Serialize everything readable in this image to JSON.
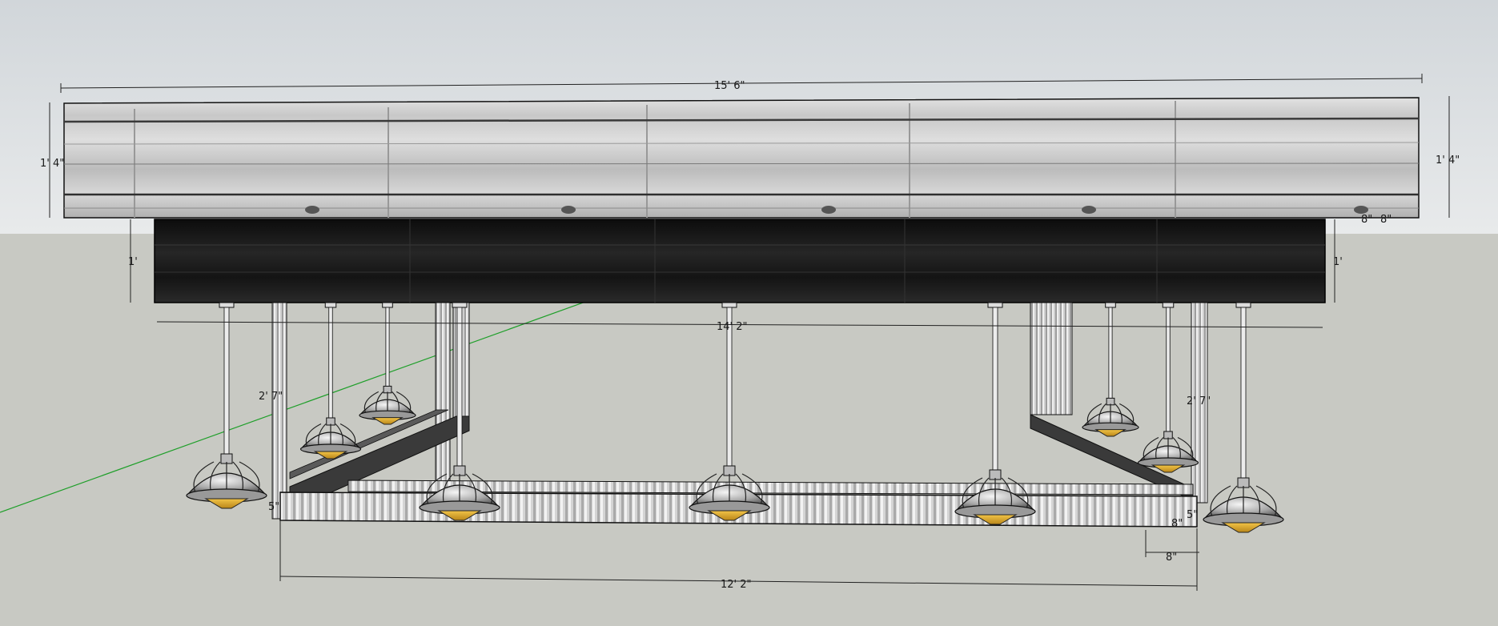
{
  "colors": {
    "sky_top": "#d3d8dc",
    "sky_bottom": "#e6e8e9",
    "ground": "#c8c9c3",
    "wood_light": "#d6d6d6",
    "wood_dark": "#151515",
    "metal": "#cfcfcf",
    "lamp_amber": "#e0a92a",
    "axis_green": "#22a02a",
    "outline": "#111111"
  },
  "dimensions": {
    "top_width": "15' 6\"",
    "top_height_left": "1' 4\"",
    "top_height_right": "1' 4\"",
    "dark_beam_height_left": "1'",
    "dark_beam_height_right": "1'",
    "dark_beam_width": "14' 2\"",
    "frame_height_left": "2' 7\"",
    "frame_height_right": "2' 7\"",
    "rail_height_left": "5\"",
    "rail_height_right": "5\"",
    "rail_offset_vertical": "8\"",
    "rail_offset_horizontal": "8\"",
    "frame_width": "12' 2\"",
    "top_right_small_a": "8\"",
    "top_right_small_b": "8\""
  }
}
